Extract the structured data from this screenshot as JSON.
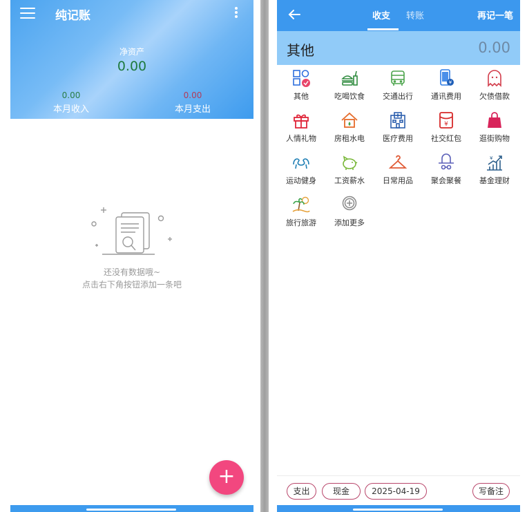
{
  "left": {
    "app_title": "纯记账",
    "net_assets_label": "净资产",
    "net_assets_value": "0.00",
    "month_income_value": "0.00",
    "month_income_label": "本月收入",
    "month_expense_value": "0.00",
    "month_expense_label": "本月支出",
    "empty_line1": "还没有数据哦~",
    "empty_line2": "点击右下角按钮添加一条吧",
    "fab_symbol": "+",
    "icons": {
      "menu": "menu-icon",
      "more": "more-vertical-icon",
      "empty": "empty-document-search-icon",
      "add": "plus-icon"
    }
  },
  "right": {
    "tabs": [
      {
        "label": "收支",
        "active": true
      },
      {
        "label": "转账",
        "active": false
      }
    ],
    "again_label": "再记一笔",
    "selected_category": "其他",
    "amount": "0.00",
    "categories": [
      {
        "label": "其他",
        "icon": "grid-check-icon",
        "color": "#2f6fde"
      },
      {
        "label": "吃喝饮食",
        "icon": "food-icon",
        "color": "#2e8b3e"
      },
      {
        "label": "交通出行",
        "icon": "bus-icon",
        "color": "#4aa34a"
      },
      {
        "label": "通讯费用",
        "icon": "phone-icon",
        "color": "#2c7be5"
      },
      {
        "label": "欠债借款",
        "icon": "ghost-icon",
        "color": "#d23c4a"
      },
      {
        "label": "人情礼物",
        "icon": "gift-icon",
        "color": "#e0263a"
      },
      {
        "label": "房租水电",
        "icon": "house-icon",
        "color": "#e56b2a"
      },
      {
        "label": "医疗费用",
        "icon": "hospital-icon",
        "color": "#2c5fae"
      },
      {
        "label": "社交红包",
        "icon": "red-envelope-icon",
        "color": "#d62828"
      },
      {
        "label": "逛街购物",
        "icon": "shopping-bag-icon",
        "color": "#d8245a"
      },
      {
        "label": "运动健身",
        "icon": "muscle-icon",
        "color": "#1f7fb5"
      },
      {
        "label": "工资薪水",
        "icon": "piggy-bank-icon",
        "color": "#7ab83a"
      },
      {
        "label": "日常用品",
        "icon": "hanger-icon",
        "color": "#e05a35"
      },
      {
        "label": "聚会聚餐",
        "icon": "hat-icon",
        "color": "#5a5fb8"
      },
      {
        "label": "基金理财",
        "icon": "chart-up-icon",
        "color": "#2a5d8a"
      },
      {
        "label": "旅行旅游",
        "icon": "palm-tree-icon",
        "color": "#e6a13a"
      },
      {
        "label": "添加更多",
        "icon": "plus-circle-icon",
        "color": "#8a8a8a"
      }
    ],
    "chips": {
      "type": "支出",
      "account": "现金",
      "date": "2025-04-19",
      "note": "写备注"
    },
    "icons": {
      "back": "arrow-left-icon"
    }
  }
}
